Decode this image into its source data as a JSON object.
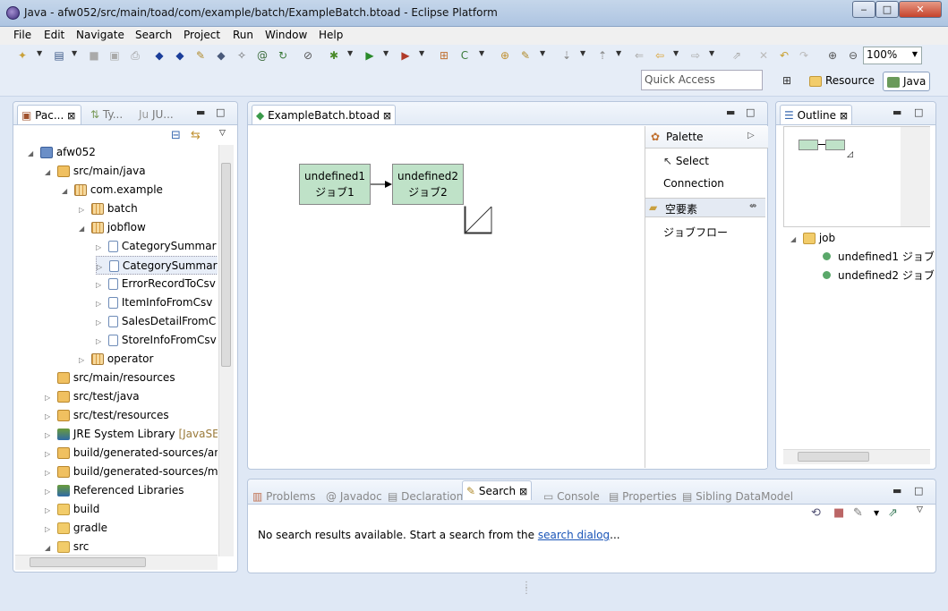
{
  "window": {
    "title": "Java - afw052/src/main/toad/com/example/batch/ExampleBatch.btoad - Eclipse Platform",
    "min": "‒",
    "max": "□",
    "close": "✕"
  },
  "menu": [
    "File",
    "Edit",
    "Navigate",
    "Search",
    "Project",
    "Run",
    "Window",
    "Help"
  ],
  "toolbar": {
    "zoom": "100%",
    "quick_access_placeholder": "Quick Access"
  },
  "perspectives": {
    "resource": "Resource",
    "java": "Java"
  },
  "left_panel": {
    "tabs": [
      "Pac...",
      "Ty...",
      "JU..."
    ],
    "tree": [
      {
        "label": "afw052",
        "indent": 0,
        "exp": "◢",
        "icon": "proj"
      },
      {
        "label": "src/main/java",
        "indent": 1,
        "exp": "◢",
        "icon": "pkg"
      },
      {
        "label": "com.example",
        "indent": 2,
        "exp": "◢",
        "icon": "pkgd"
      },
      {
        "label": "batch",
        "indent": 3,
        "exp": "▷",
        "icon": "pkgd"
      },
      {
        "label": "jobflow",
        "indent": 3,
        "exp": "◢",
        "icon": "pkgd"
      },
      {
        "label": "CategorySummar",
        "indent": 4,
        "exp": "▷",
        "icon": "jfile"
      },
      {
        "label": "CategorySummar",
        "indent": 4,
        "exp": "▷",
        "icon": "jfile"
      },
      {
        "label": "ErrorRecordToCsv",
        "indent": 4,
        "exp": "▷",
        "icon": "jfile"
      },
      {
        "label": "ItemInfoFromCsv",
        "indent": 4,
        "exp": "▷",
        "icon": "jfile"
      },
      {
        "label": "SalesDetailFromC",
        "indent": 4,
        "exp": "▷",
        "icon": "jfile"
      },
      {
        "label": "StoreInfoFromCsv",
        "indent": 4,
        "exp": "▷",
        "icon": "jfile"
      },
      {
        "label": "operator",
        "indent": 3,
        "exp": "▷",
        "icon": "pkgd"
      },
      {
        "label": "src/main/resources",
        "indent": 1,
        "exp": "",
        "icon": "pkg"
      },
      {
        "label": "src/test/java",
        "indent": 1,
        "exp": "▷",
        "icon": "pkg"
      },
      {
        "label": "src/test/resources",
        "indent": 1,
        "exp": "▷",
        "icon": "pkg"
      },
      {
        "label": "JRE System Library",
        "suffix": " [JavaSE",
        "indent": 1,
        "exp": "▷",
        "icon": "lib"
      },
      {
        "label": "build/generated-sources/an",
        "indent": 1,
        "exp": "▷",
        "icon": "pkg"
      },
      {
        "label": "build/generated-sources/mo",
        "indent": 1,
        "exp": "▷",
        "icon": "pkg"
      },
      {
        "label": "Referenced Libraries",
        "indent": 1,
        "exp": "▷",
        "icon": "lib"
      },
      {
        "label": "build",
        "indent": 1,
        "exp": "▷",
        "icon": "fold"
      },
      {
        "label": "gradle",
        "indent": 1,
        "exp": "▷",
        "icon": "fold"
      },
      {
        "label": "src",
        "indent": 1,
        "exp": "◢",
        "icon": "fold"
      }
    ]
  },
  "editor": {
    "tab": "ExampleBatch.btoad",
    "nodes": [
      {
        "line1": "undefined1",
        "line2": "ジョブ1"
      },
      {
        "line1": "undefined2",
        "line2": "ジョブ2"
      }
    ],
    "palette": {
      "title": "Palette",
      "select": "Select",
      "connection": "Connection",
      "drawer": "空要素",
      "item": "ジョブフロー"
    }
  },
  "outline": {
    "tab": "Outline",
    "root": "job",
    "items": [
      "undefined1 ジョブ",
      "undefined2 ジョブ"
    ]
  },
  "bottom": {
    "tabs": [
      "Problems",
      "Javadoc",
      "Declaration",
      "Search",
      "Console",
      "Properties",
      "Sibling DataModel"
    ],
    "message_prefix": "No search results available. Start a search from the ",
    "message_link": "search dialog",
    "message_suffix": "..."
  },
  "colors": {
    "node_fill": "#bfe2c8",
    "link": "#1a55b8"
  }
}
